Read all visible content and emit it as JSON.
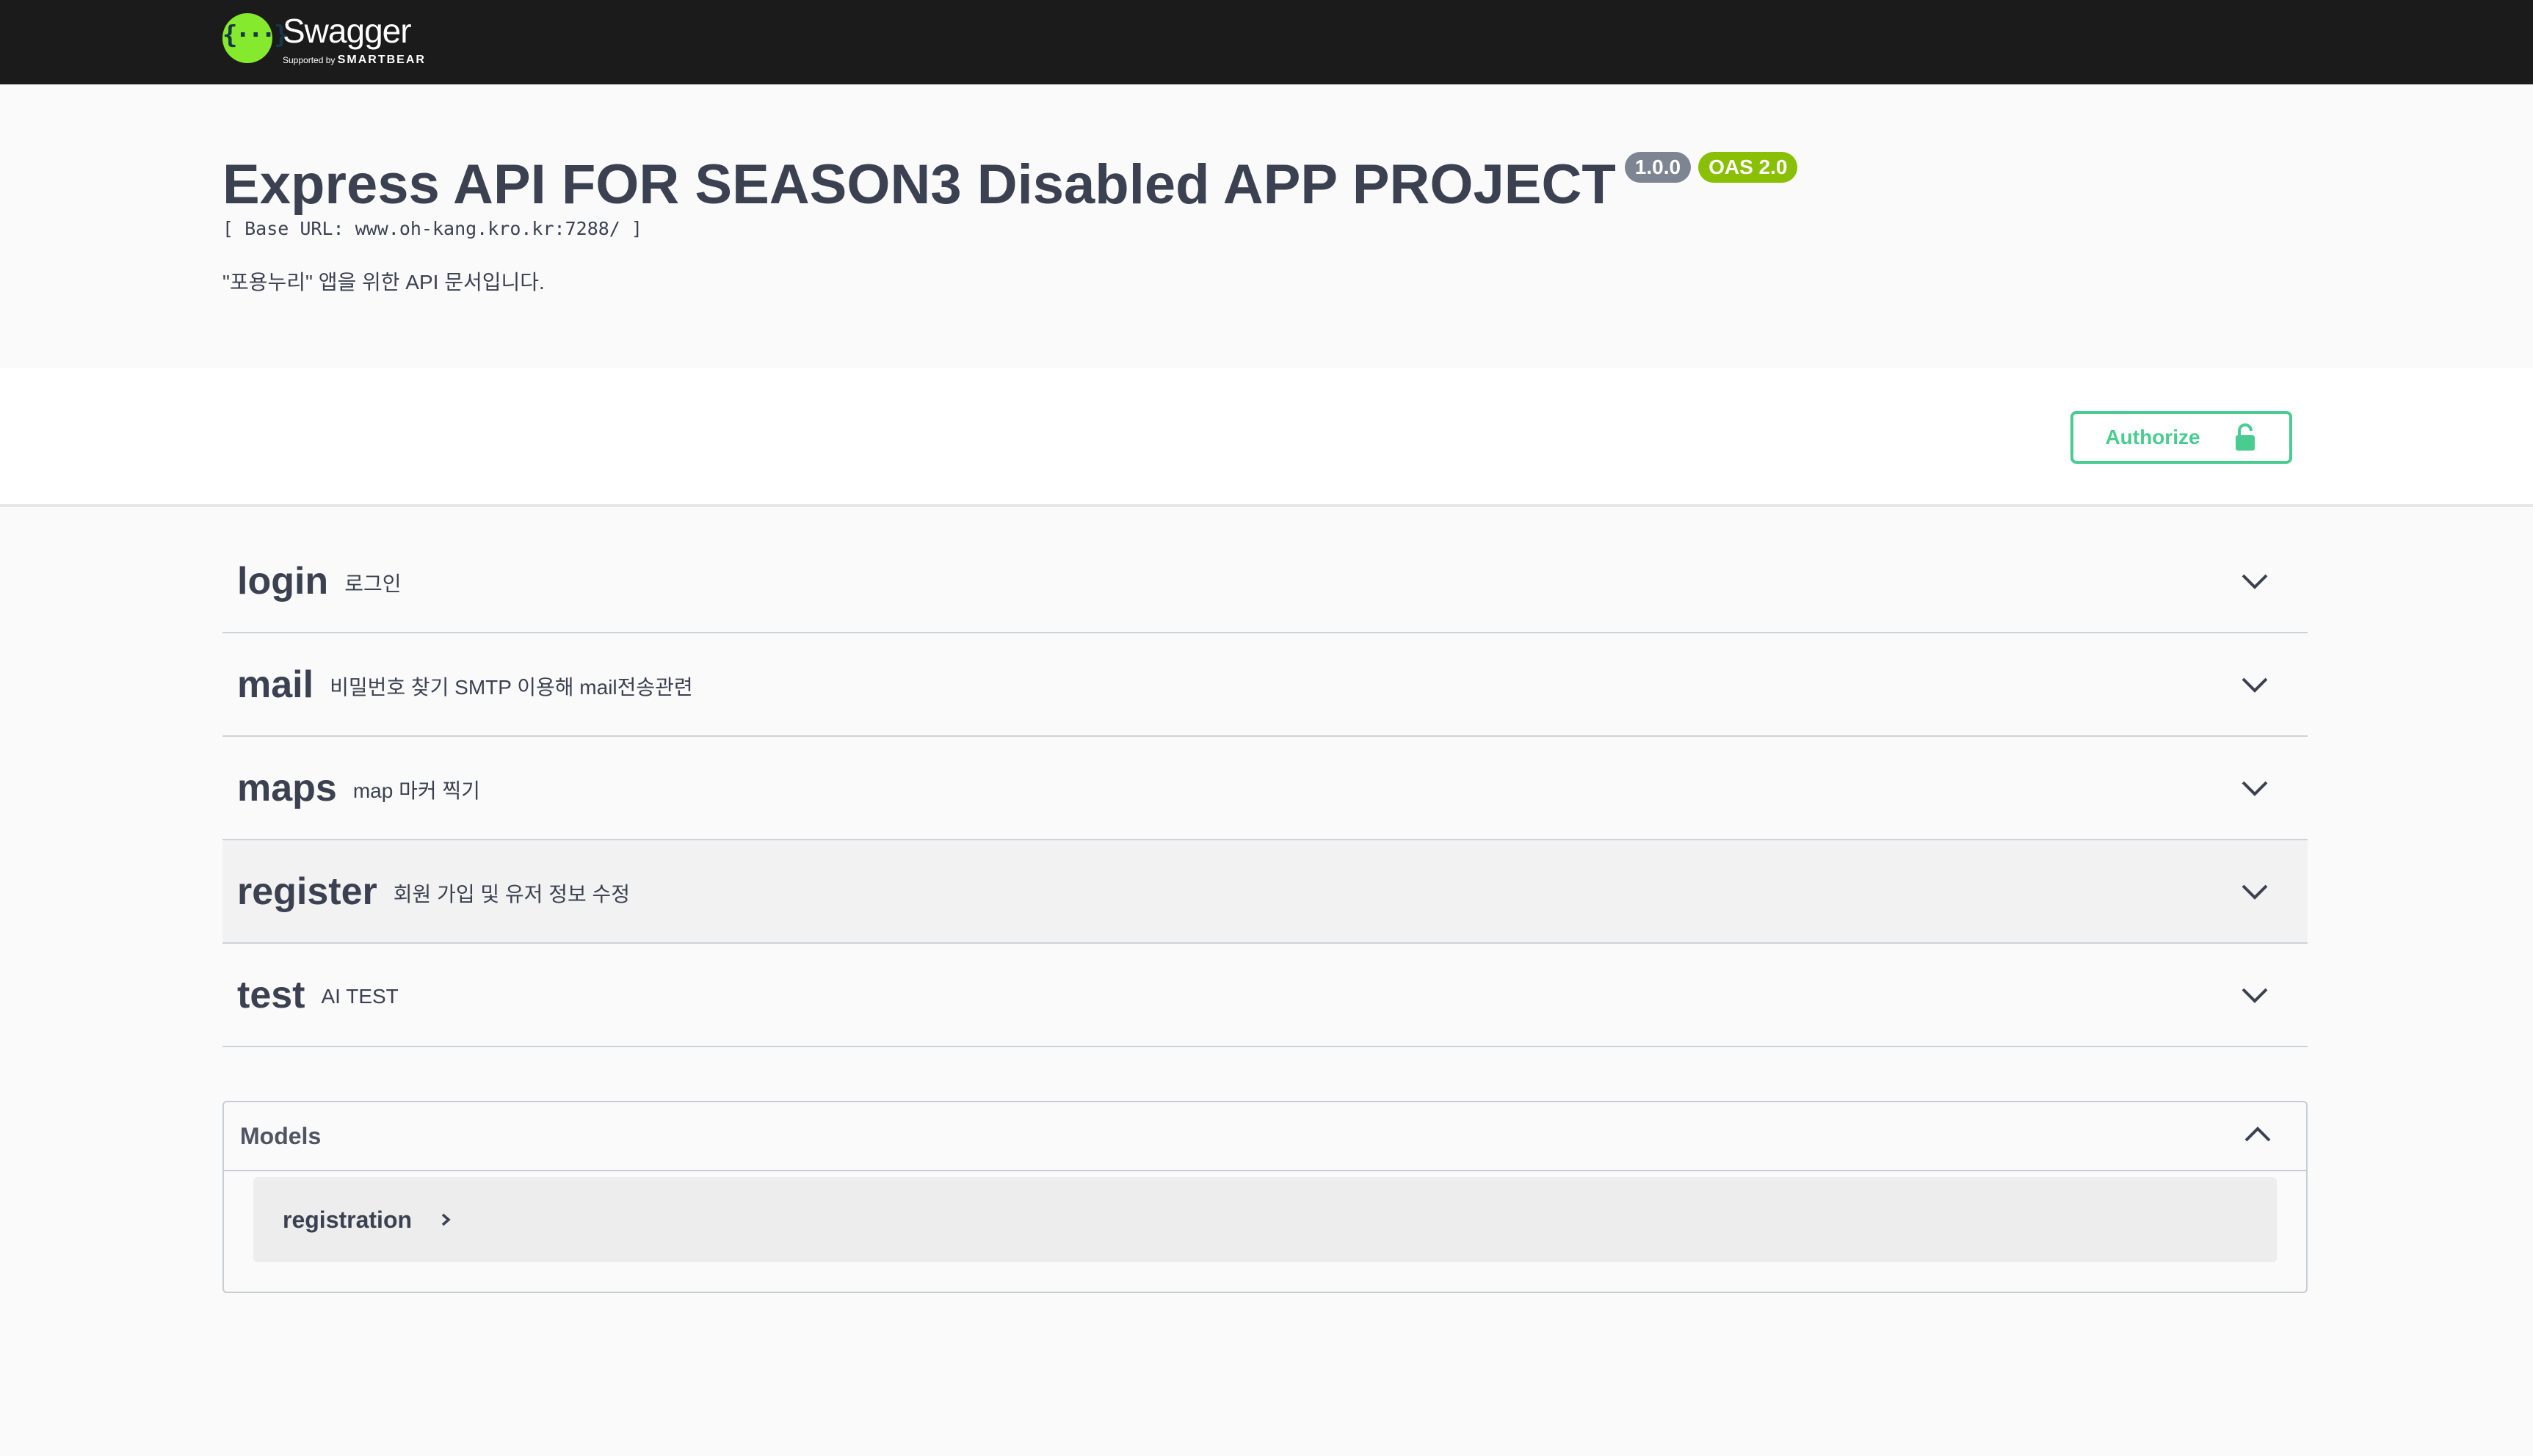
{
  "topbar": {
    "brand_name": "Swagger",
    "brand_supported_by": "Supported by",
    "brand_company": "SMARTBEAR",
    "logo_glyph": "{···}",
    "logo_icon": "swagger-logo-icon"
  },
  "info": {
    "title": "Express API FOR SEASON3 Disabled APP PROJECT",
    "version": "1.0.0",
    "oas": "OAS 2.0",
    "base_url": "[ Base URL: www.oh-kang.kro.kr:7288/ ]",
    "description": "\"포용누리\" 앱을 위한 API 문서입니다."
  },
  "scheme": {
    "authorize_label": "Authorize",
    "lock_icon": "unlocked-padlock-icon"
  },
  "tags": [
    {
      "name": "login",
      "description": "로그인",
      "icon": "chevron-down-icon"
    },
    {
      "name": "mail",
      "description": "비밀번호 찾기 SMTP 이용해 mail전송관련",
      "icon": "chevron-down-icon"
    },
    {
      "name": "maps",
      "description": "map 마커 찍기",
      "icon": "chevron-down-icon"
    },
    {
      "name": "register",
      "description": "회원 가입 및 유저 정보 수정",
      "icon": "chevron-down-icon"
    },
    {
      "name": "test",
      "description": "AI TEST",
      "icon": "chevron-down-icon"
    }
  ],
  "models": {
    "title": "Models",
    "icon": "chevron-up-icon",
    "items": [
      {
        "name": "registration",
        "icon": "chevron-right-icon"
      }
    ]
  },
  "colors": {
    "topbar_bg": "#1b1b1b",
    "logo_green": "#85ea2d",
    "authorize_green": "#49cc90",
    "version_badge": "#7d8492",
    "oas_badge": "#89bf04",
    "text_primary": "#3b4151"
  }
}
